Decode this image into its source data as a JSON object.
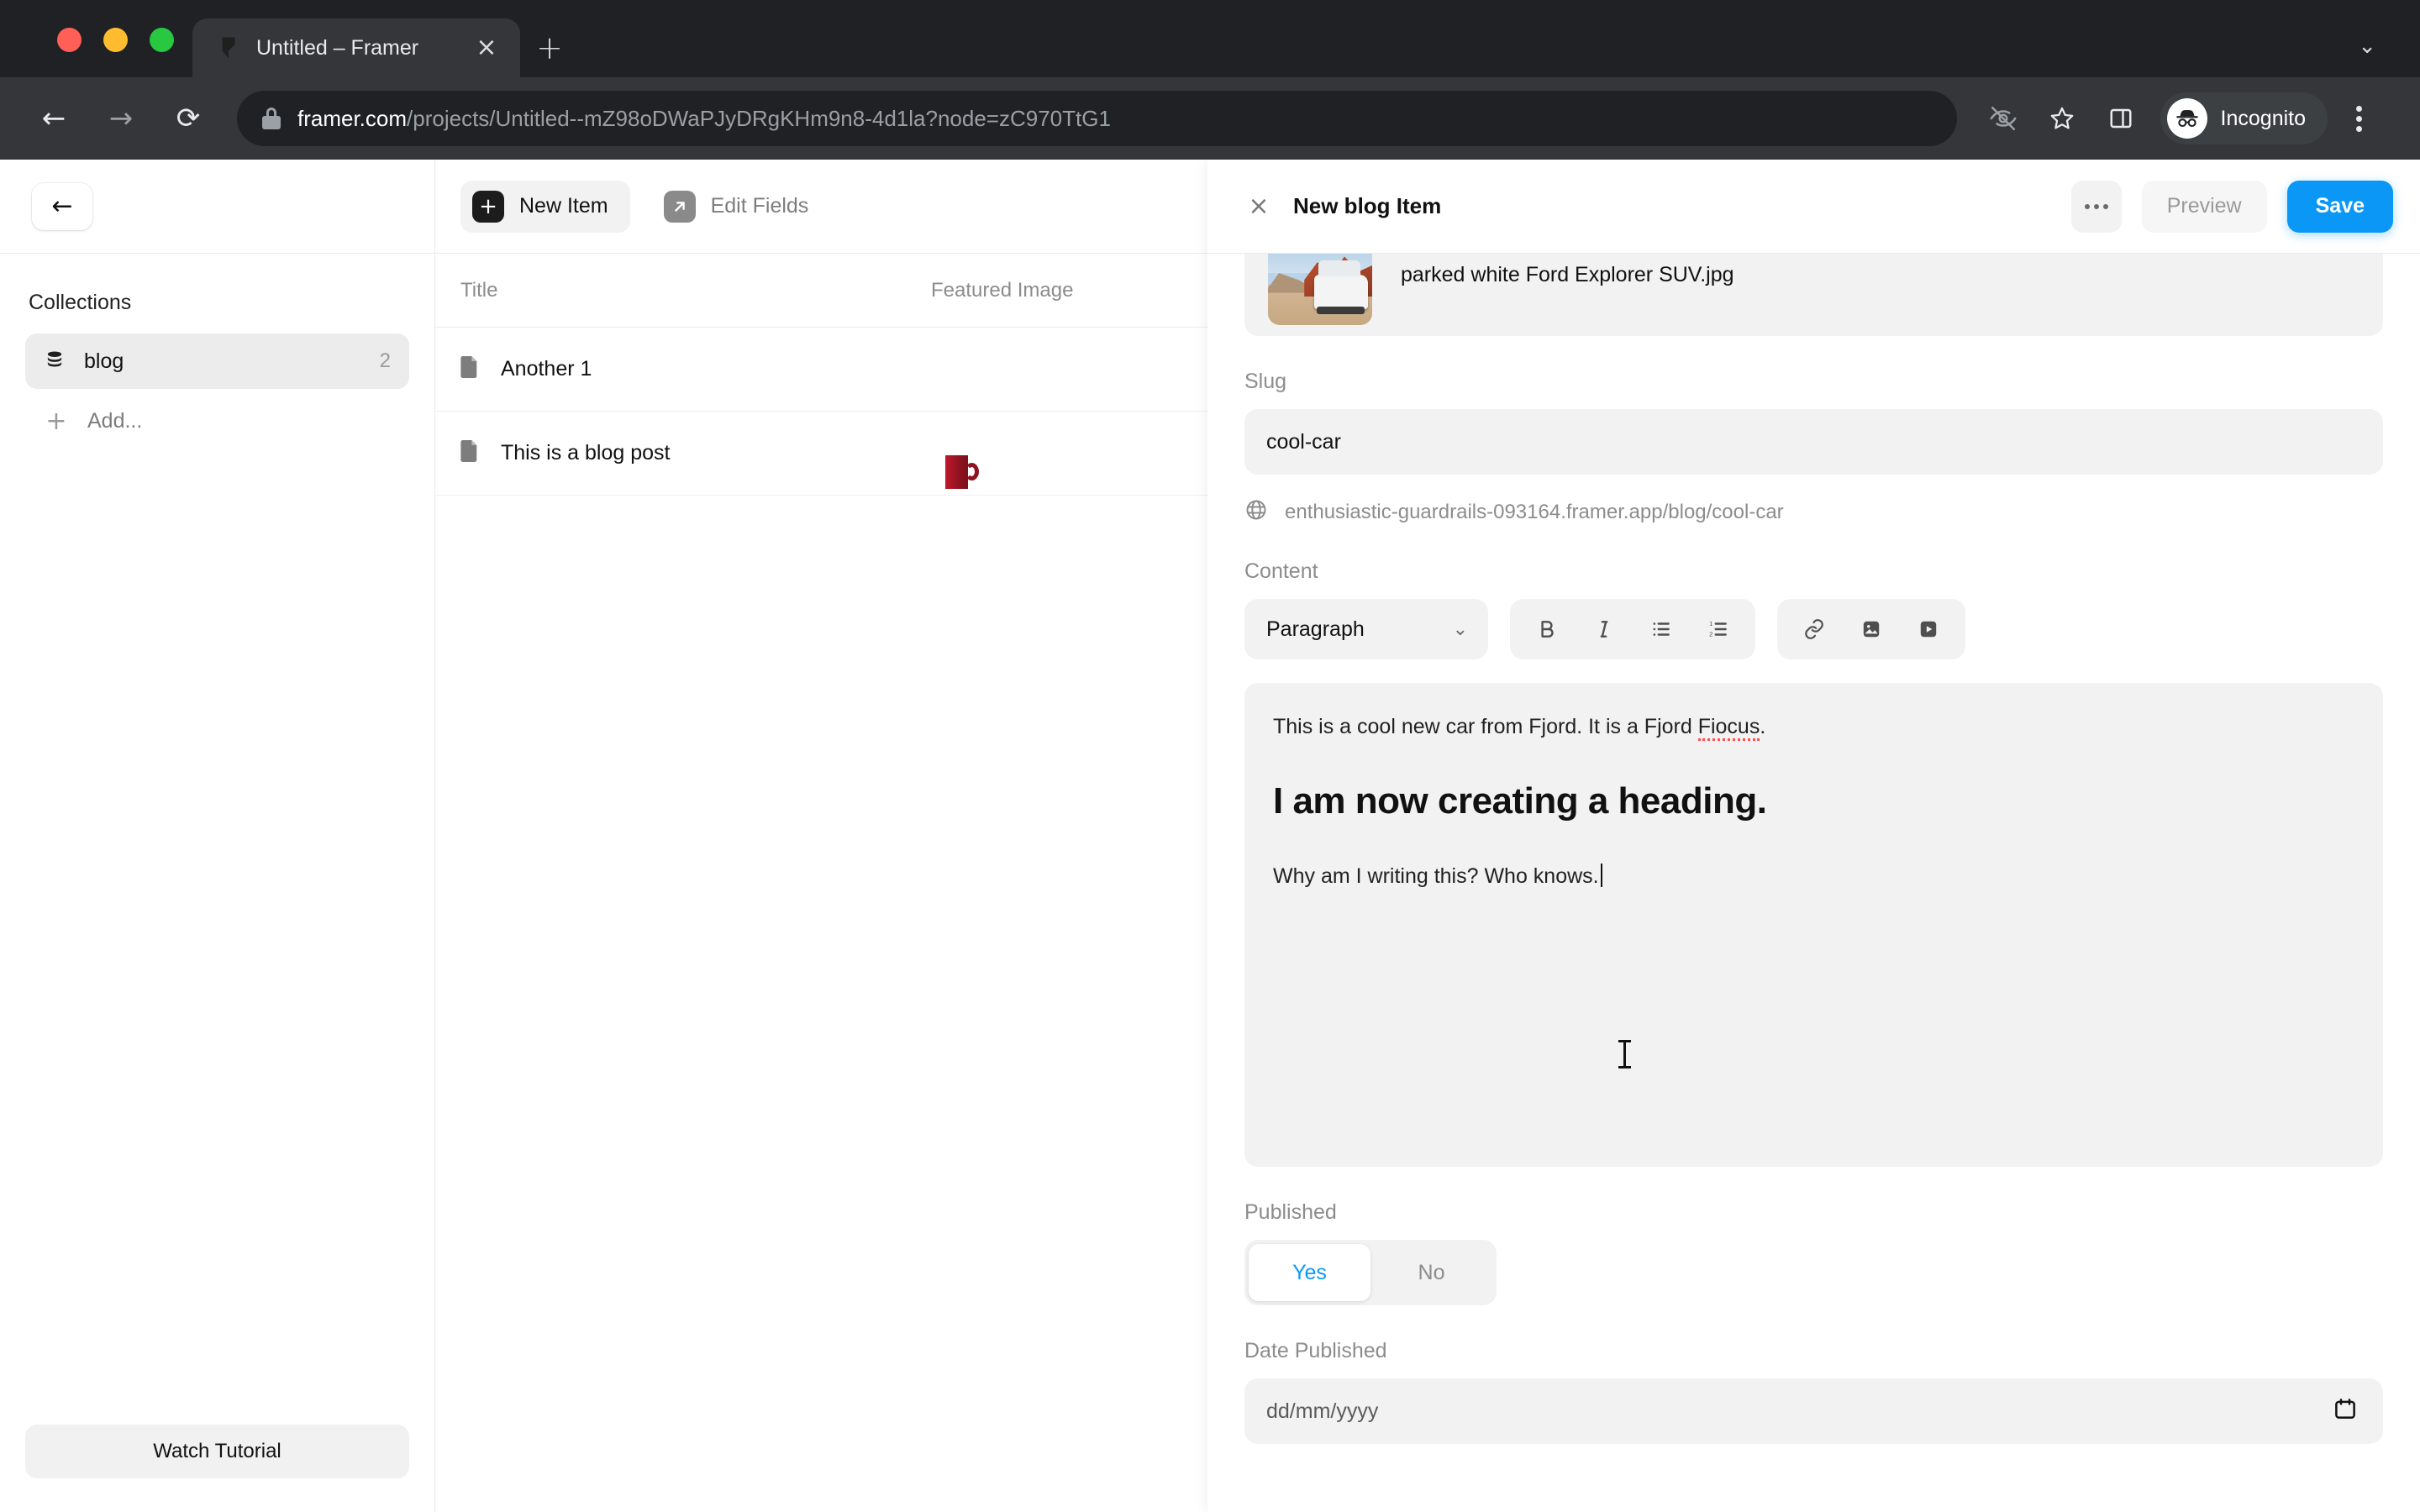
{
  "browser": {
    "tab": {
      "title": "Untitled – Framer",
      "favicon": "framer-logo-icon",
      "close": "×"
    },
    "new_tab": "+",
    "tab_list_chevron": "⌄",
    "nav": {
      "back": "←",
      "forward": "→",
      "reload": "⟳"
    },
    "url": {
      "host": "framer.com",
      "path": "/projects/Untitled--mZ98oDWaPJyDRgKHm9n8-4d1la?node=zC970TtG1"
    },
    "toolbar_icons": [
      "eye-off-icon",
      "star-icon",
      "side-panel-icon"
    ],
    "profile": {
      "label": "Incognito",
      "icon": "incognito-hat-icon"
    },
    "menu": "kebab-menu-icon"
  },
  "sidebar": {
    "back_button": "←",
    "section_title": "Collections",
    "items": [
      {
        "label": "blog",
        "count": "2",
        "icon": "database-icon",
        "active": true
      }
    ],
    "add": {
      "label": "Add...",
      "icon": "plus-icon"
    },
    "watch_tutorial": "Watch Tutorial"
  },
  "middle": {
    "toolbar": {
      "new_item": {
        "label": "New Item",
        "icon": "plus-square-icon"
      },
      "edit_fields": {
        "label": "Edit Fields",
        "icon": "arrow-up-right-icon"
      }
    },
    "columns": [
      "Title",
      "Featured Image"
    ],
    "rows": [
      {
        "title": "Another 1",
        "icon": "document-icon",
        "thumb": "empty"
      },
      {
        "title": "This is a blog post",
        "icon": "document-icon",
        "thumb": "red-mug"
      }
    ]
  },
  "panel": {
    "close": "×",
    "title": "New blog Item",
    "more": "more-options-icon",
    "preview": "Preview",
    "save": "Save",
    "featured_image": {
      "filename": "parked white Ford Explorer SUV.jpg",
      "remove_icon": "remove-image-icon"
    },
    "slug": {
      "label": "Slug",
      "value": "cool-car",
      "url_icon": "globe-icon",
      "url": "enthusiastic-guardrails-093164.framer.app/blog/cool-car"
    },
    "content": {
      "label": "Content",
      "block_type": "Paragraph",
      "block_chevron": "⌄",
      "format_buttons": [
        "bold-icon",
        "italic-icon",
        "bullet-list-icon",
        "numbered-list-icon"
      ],
      "insert_buttons": [
        "link-icon",
        "image-icon",
        "video-icon"
      ],
      "body": {
        "paragraph_1_before": "This is a cool new car from Fjord. It is a Fjord ",
        "paragraph_1_misspelled": "Fiocus",
        "paragraph_1_after": ".",
        "heading": "I am now creating a heading.",
        "paragraph_2": "Why am I writing this? Who knows."
      }
    },
    "published": {
      "label": "Published",
      "options": [
        "Yes",
        "No"
      ],
      "selected": "Yes"
    },
    "date_published": {
      "label": "Date Published",
      "placeholder": "dd/mm/yyyy",
      "icon": "calendar-icon"
    }
  },
  "colors": {
    "accent_blue": "#0a97f5",
    "chrome_dark": "#202124",
    "chrome_tab": "#35363a",
    "field_gray": "#f2f2f2",
    "spellcheck_red": "#ff4d4f"
  }
}
